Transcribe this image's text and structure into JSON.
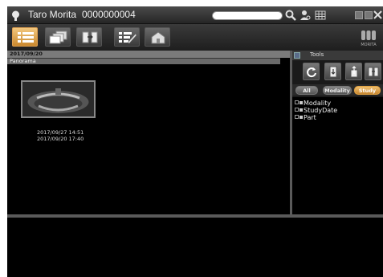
{
  "window": {
    "patient_name": "Taro Morita",
    "patient_id": "0000000004",
    "search_placeholder": ""
  },
  "toolbar": {
    "buttons": [
      {
        "name": "list-view",
        "active": true
      },
      {
        "name": "image-view",
        "active": false
      },
      {
        "name": "transfer",
        "active": false
      },
      {
        "name": "report",
        "active": false
      },
      {
        "name": "home",
        "active": false
      }
    ],
    "logo_text": "MORITA"
  },
  "study": {
    "date": "2017/09/20",
    "series_label": "Panorama",
    "timestamps": [
      "2017/09/27 14:51",
      "2017/09/20 17:40"
    ]
  },
  "tools": {
    "title": "Tools",
    "filters": [
      {
        "label": "All",
        "active": false
      },
      {
        "label": "Modality",
        "active": false
      },
      {
        "label": "Study",
        "active": true
      }
    ],
    "tree": [
      "Modality",
      "StudyDate",
      "Part"
    ]
  },
  "colors": {
    "accent": "#d9973f",
    "panel_bg": "#000000",
    "bar_bg": "#7b7b7b"
  }
}
